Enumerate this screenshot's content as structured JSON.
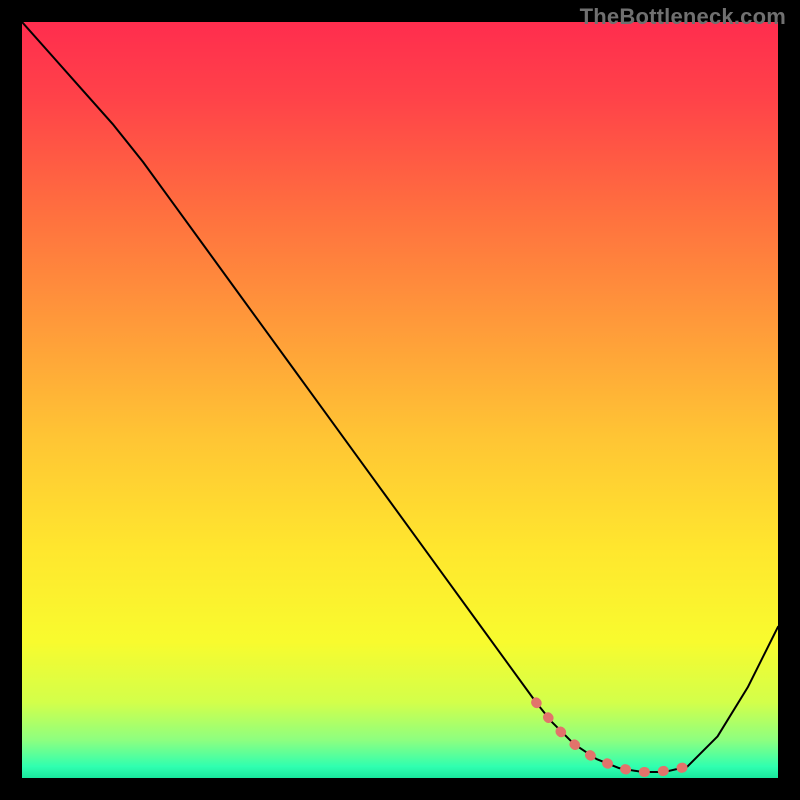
{
  "watermark": "TheBottleneck.com",
  "colors": {
    "page_bg": "#000000",
    "curve_stroke": "#000000",
    "marker_stroke": "#e2736b",
    "gradient_stops": [
      {
        "offset": 0.0,
        "color": "#ff2d4e"
      },
      {
        "offset": 0.1,
        "color": "#ff4249"
      },
      {
        "offset": 0.25,
        "color": "#ff6f3f"
      },
      {
        "offset": 0.4,
        "color": "#ff9a3a"
      },
      {
        "offset": 0.55,
        "color": "#ffc534"
      },
      {
        "offset": 0.7,
        "color": "#ffe72e"
      },
      {
        "offset": 0.82,
        "color": "#f8fb2e"
      },
      {
        "offset": 0.9,
        "color": "#d3ff4a"
      },
      {
        "offset": 0.95,
        "color": "#8dff80"
      },
      {
        "offset": 0.985,
        "color": "#2fffb0"
      },
      {
        "offset": 1.0,
        "color": "#19e69d"
      }
    ]
  },
  "chart_data": {
    "type": "line",
    "title": "",
    "xlabel": "",
    "ylabel": "",
    "xlim": [
      0,
      100
    ],
    "ylim": [
      0,
      100
    ],
    "series": [
      {
        "name": "bottleneck-curve",
        "x": [
          0,
          4,
          8,
          12,
          16,
          20,
          24,
          28,
          32,
          36,
          40,
          44,
          48,
          52,
          56,
          60,
          64,
          68,
          70,
          73,
          76,
          79,
          82,
          85,
          88,
          92,
          96,
          100
        ],
        "y": [
          100,
          95.5,
          91,
          86.5,
          81.5,
          76,
          70.5,
          65,
          59.5,
          54,
          48.5,
          43,
          37.5,
          32,
          26.5,
          21,
          15.5,
          10,
          7.5,
          4.5,
          2.5,
          1.3,
          0.8,
          0.8,
          1.5,
          5.5,
          12,
          20
        ]
      }
    ],
    "optimal_zone": {
      "x": [
        68,
        70,
        72,
        74,
        76,
        78,
        80,
        82,
        84,
        86,
        88
      ],
      "y": [
        10,
        7.5,
        5.3,
        3.7,
        2.5,
        1.7,
        1.1,
        0.8,
        0.8,
        1.1,
        1.5
      ]
    },
    "legend": [],
    "grid": false
  }
}
